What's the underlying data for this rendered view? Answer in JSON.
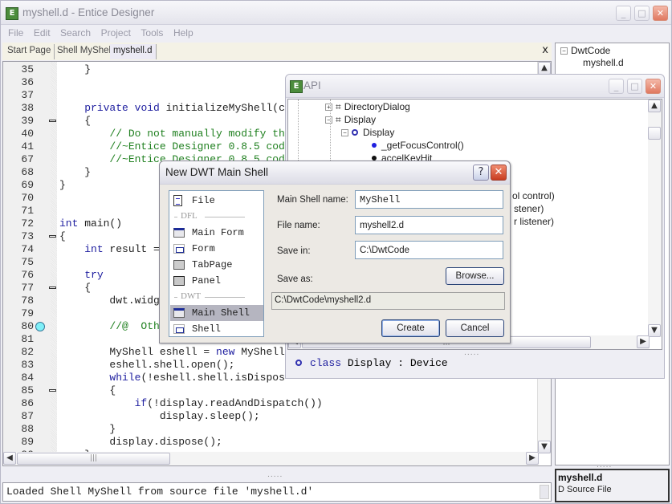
{
  "window": {
    "title": "myshell.d - Entice Designer",
    "app_icon": "E",
    "controls": {
      "minimize": "_",
      "maximize": "□",
      "close": "✕"
    }
  },
  "menu": [
    "File",
    "Edit",
    "Search",
    "Project",
    "Tools",
    "Help"
  ],
  "tabs": [
    {
      "label": "Start Page",
      "active": false
    },
    {
      "label": "Shell MyShell",
      "active": false
    },
    {
      "label": "myshell.d",
      "active": true
    }
  ],
  "tab_close": "x",
  "editor": {
    "lines": [
      {
        "n": "35",
        "code": "    }",
        "type": "plain"
      },
      {
        "n": "36",
        "code": "",
        "type": "plain"
      },
      {
        "n": "37",
        "code": "",
        "type": "plain"
      },
      {
        "n": "38",
        "code": "    private void initializeMyShell(c",
        "type": "decl"
      },
      {
        "n": "39",
        "code": "    {",
        "type": "plain",
        "fold": true
      },
      {
        "n": "40",
        "code": "        // Do not manually modify th",
        "type": "comment"
      },
      {
        "n": "41",
        "code": "        //~Entice Designer 0.8.5 cod",
        "type": "comment"
      },
      {
        "n": "67",
        "code": "        //~Entice Designer 0.8.5 cod",
        "type": "comment"
      },
      {
        "n": "68",
        "code": "    }",
        "type": "plain"
      },
      {
        "n": "69",
        "code": "}",
        "type": "plain"
      },
      {
        "n": "70",
        "code": "",
        "type": "plain"
      },
      {
        "n": "71",
        "code": "",
        "type": "plain"
      },
      {
        "n": "72",
        "code": "int main()",
        "type": "main"
      },
      {
        "n": "73",
        "code": "{",
        "type": "plain",
        "fold": true
      },
      {
        "n": "74",
        "code": "    int result = ",
        "type": "int"
      },
      {
        "n": "75",
        "code": "",
        "type": "plain"
      },
      {
        "n": "76",
        "code": "    try",
        "type": "kw"
      },
      {
        "n": "77",
        "code": "    {",
        "type": "plain",
        "fold": true
      },
      {
        "n": "78",
        "code": "        dwt.widg",
        "type": "plain"
      },
      {
        "n": "79",
        "code": "",
        "type": "plain"
      },
      {
        "n": "80",
        "code": "        //@  Oth",
        "type": "comment",
        "breakpoint": true
      },
      {
        "n": "81",
        "code": "",
        "type": "plain"
      },
      {
        "n": "82",
        "code": "        MyShell eshell = new MyShell",
        "type": "new"
      },
      {
        "n": "83",
        "code": "        eshell.shell.open();",
        "type": "plain"
      },
      {
        "n": "84",
        "code": "        while(!eshell.shell.isDispos",
        "type": "while"
      },
      {
        "n": "85",
        "code": "        {",
        "type": "plain",
        "fold": true
      },
      {
        "n": "86",
        "code": "            if(!display.readAndDispatch())",
        "type": "if"
      },
      {
        "n": "87",
        "code": "                display.sleep();",
        "type": "plain"
      },
      {
        "n": "88",
        "code": "        }",
        "type": "plain"
      },
      {
        "n": "89",
        "code": "        display.dispose();",
        "type": "plain"
      },
      {
        "n": "90",
        "code": "    }",
        "type": "plain"
      }
    ]
  },
  "console": {
    "text": "Loaded Shell MyShell from source file 'myshell.d'"
  },
  "project_tree": {
    "root": "DwtCode",
    "children": [
      "myshell.d"
    ]
  },
  "info_panel": {
    "name": "myshell.d",
    "type": "D Source File"
  },
  "api_window": {
    "title": "API",
    "tree": [
      {
        "label": "DirectoryDialog",
        "expander": "+",
        "icon": "class-cube-icon"
      },
      {
        "label": "Display",
        "expander": "-",
        "icon": "class-cube-icon"
      },
      {
        "label": "Display",
        "expander": "-",
        "icon": "class-ring-icon"
      },
      {
        "label": "_getFocusControl()",
        "icon": "method-blue-dot-icon"
      },
      {
        "label": "accelKeyHit",
        "icon": "field-black-dot-icon"
      }
    ],
    "partial_lines": [
      "ol control)",
      "stener)",
      "r listener)"
    ],
    "description": {
      "keyword": "class",
      "name": "Display",
      "sep": ":",
      "base": "Device"
    }
  },
  "dialog": {
    "title": "New DWT Main Shell",
    "help": "?",
    "close": "✕",
    "templates": [
      {
        "kind": "item",
        "label": "File",
        "icon": "file"
      },
      {
        "kind": "sep",
        "label": "DFL"
      },
      {
        "kind": "item",
        "label": "Main Form",
        "icon": "main"
      },
      {
        "kind": "item",
        "label": "Form",
        "icon": "form"
      },
      {
        "kind": "item",
        "label": "TabPage",
        "icon": "tabp"
      },
      {
        "kind": "item",
        "label": "Panel",
        "icon": "panel"
      },
      {
        "kind": "sep",
        "label": "DWT"
      },
      {
        "kind": "item",
        "label": "Main Shell",
        "icon": "main",
        "selected": true
      },
      {
        "kind": "item",
        "label": "Shell",
        "icon": "form"
      }
    ],
    "fields": {
      "main_shell_name_label": "Main Shell name:",
      "main_shell_name": "MyShell",
      "file_name_label": "File name:",
      "file_name": "myshell2.d",
      "save_in_label": "Save in:",
      "save_in": "C:\\DwtCode",
      "save_as_label": "Save as:",
      "save_as": "C:\\DwtCode\\myshell2.d"
    },
    "buttons": {
      "browse": "Browse...",
      "create": "Create",
      "cancel": "Cancel"
    }
  }
}
